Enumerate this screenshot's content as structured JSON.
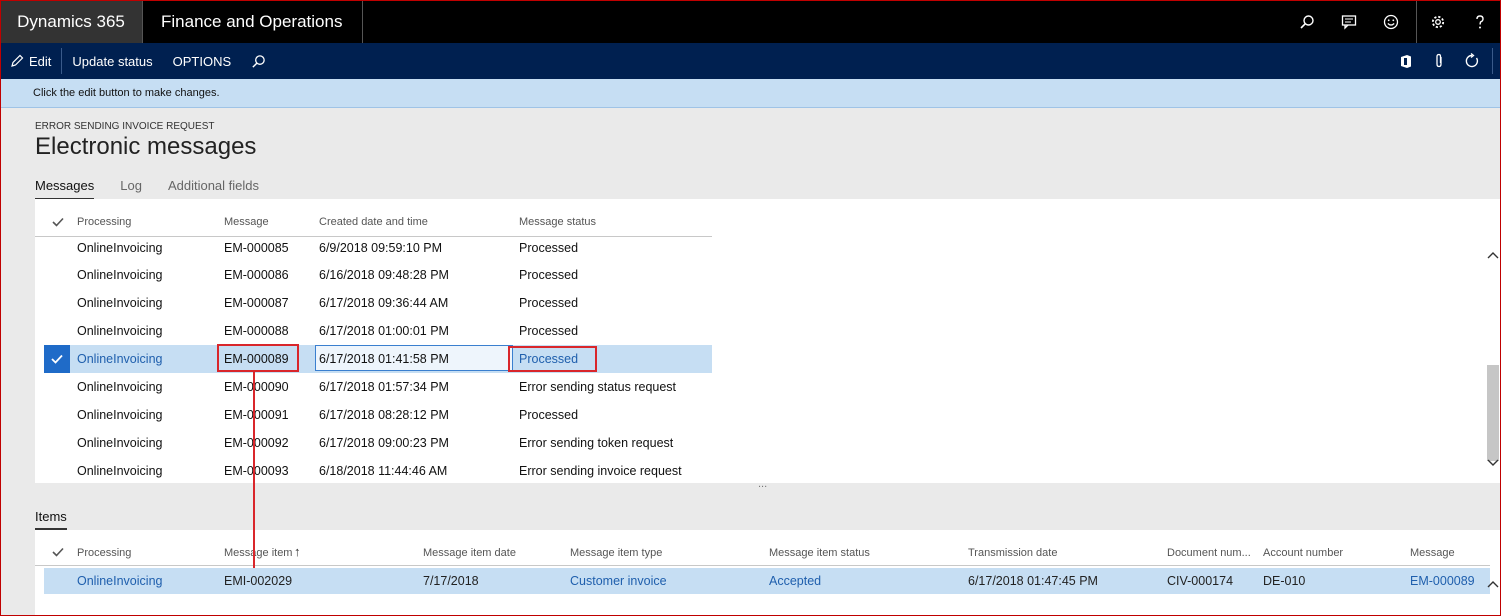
{
  "header": {
    "brand": "Dynamics 365",
    "module": "Finance and Operations"
  },
  "actionbar": {
    "edit": "Edit",
    "update_status": "Update status",
    "options": "OPTIONS"
  },
  "info": {
    "message": "Click the edit button to make changes."
  },
  "page": {
    "caption": "ERROR SENDING INVOICE REQUEST",
    "title": "Electronic messages"
  },
  "tabs": [
    {
      "label": "Messages",
      "active": true
    },
    {
      "label": "Log",
      "active": false
    },
    {
      "label": "Additional fields",
      "active": false
    }
  ],
  "messages": {
    "columns": [
      "Processing",
      "Message",
      "Created date and time",
      "Message status"
    ],
    "rows": [
      [
        "OnlineInvoicing",
        "EM-000085",
        "6/9/2018 09:59:10 PM",
        "Processed"
      ],
      [
        "OnlineInvoicing",
        "EM-000086",
        "6/16/2018 09:48:28 PM",
        "Processed"
      ],
      [
        "OnlineInvoicing",
        "EM-000087",
        "6/17/2018 09:36:44 AM",
        "Processed"
      ],
      [
        "OnlineInvoicing",
        "EM-000088",
        "6/17/2018 01:00:01 PM",
        "Processed"
      ],
      [
        "OnlineInvoicing",
        "EM-000089",
        "6/17/2018 01:41:58 PM",
        "Processed"
      ],
      [
        "OnlineInvoicing",
        "EM-000090",
        "6/17/2018 01:57:34 PM",
        "Error sending status request"
      ],
      [
        "OnlineInvoicing",
        "EM-000091",
        "6/17/2018 08:28:12 PM",
        "Processed"
      ],
      [
        "OnlineInvoicing",
        "EM-000092",
        "6/17/2018 09:00:23 PM",
        "Error sending token request"
      ],
      [
        "OnlineInvoicing",
        "EM-000093",
        "6/18/2018 11:44:46 AM",
        "Error sending invoice request"
      ]
    ],
    "selected_index": 4
  },
  "items": {
    "section_label": "Items",
    "columns": [
      "Processing",
      "Message item",
      "Message item date",
      "Message item type",
      "Message item status",
      "Transmission date",
      "Document num...",
      "Account number",
      "Message"
    ],
    "sort_indicator": "↑",
    "row": [
      "OnlineInvoicing",
      "EMI-002029",
      "7/17/2018",
      "Customer invoice",
      "Accepted",
      "6/17/2018 01:47:45 PM",
      "CIV-000174",
      "DE-010",
      "EM-000089"
    ]
  },
  "splitter": "..."
}
